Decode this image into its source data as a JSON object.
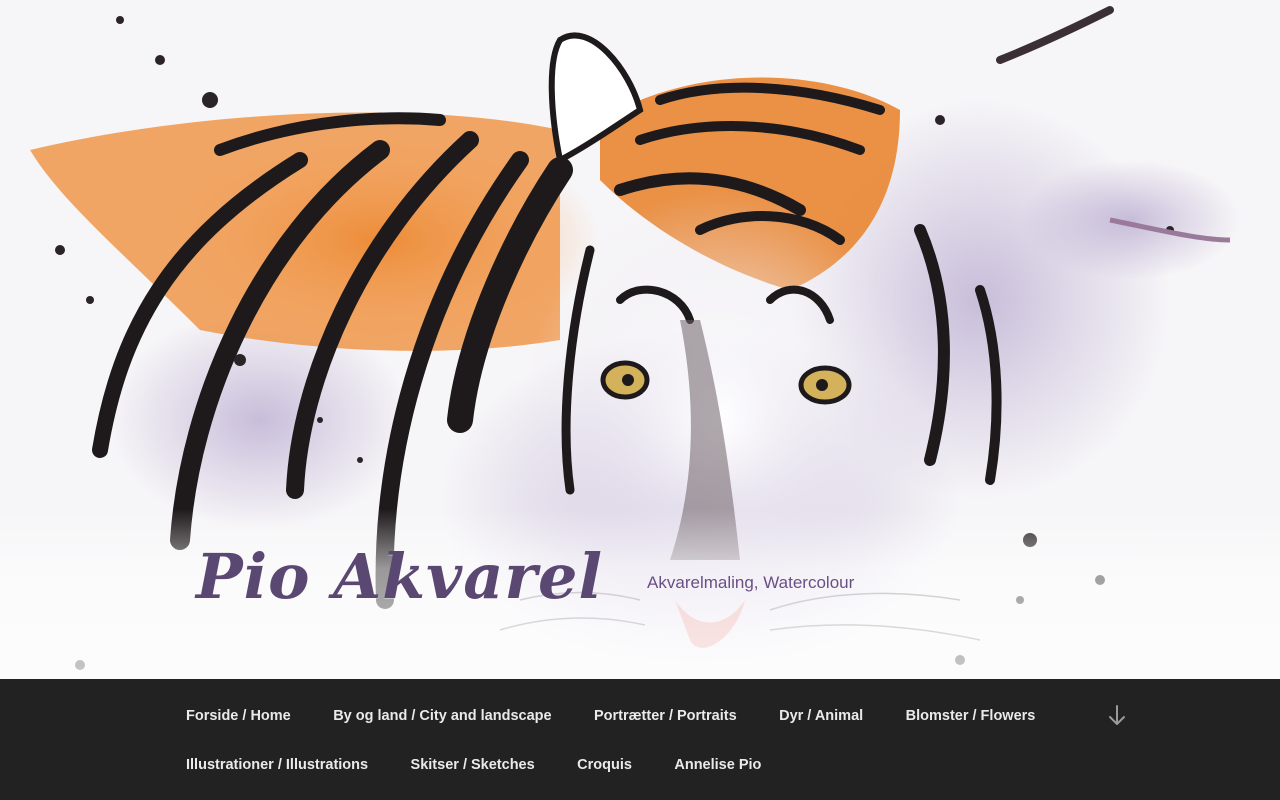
{
  "site": {
    "title": "Pio Akvarel",
    "description": "Akvarelmaling, Watercolour"
  },
  "nav": {
    "items": [
      "Forside / Home",
      "By og land / City and landscape",
      "Portrætter / Portraits",
      "Dyr / Animal",
      "Blomster / Flowers",
      "Illustrationer / Illustrations",
      "Skitser / Sketches",
      "Croquis",
      "Annelise Pio"
    ],
    "scroll_icon": "arrow-down-icon"
  },
  "colors": {
    "nav_bg": "#222222",
    "nav_text": "#eaeaea",
    "title": "#5a4873",
    "tiger_orange": "#e8873a"
  }
}
